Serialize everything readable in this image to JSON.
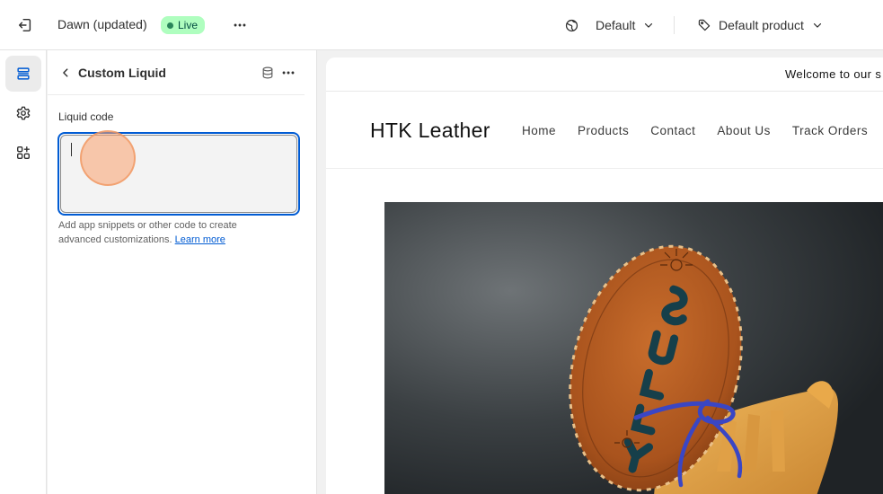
{
  "topbar": {
    "theme_name": "Dawn (updated)",
    "status_badge": "Live",
    "locale_label": "Default",
    "template_label": "Default product"
  },
  "rail": {
    "items": [
      {
        "icon": "sections-icon",
        "active": true
      },
      {
        "icon": "gear-icon",
        "active": false
      },
      {
        "icon": "apps-icon",
        "active": false
      }
    ]
  },
  "panel": {
    "title": "Custom Liquid",
    "field_label": "Liquid code",
    "code_value": "",
    "help_text": "Add app snippets or other code to create advanced customizations.",
    "help_link": "Learn more"
  },
  "preview": {
    "announcement": "Welcome to our s",
    "store_name": "HTK Leather",
    "nav": [
      "Home",
      "Products",
      "Contact",
      "About Us",
      "Track Orders"
    ]
  },
  "colors": {
    "accent": "#005bd3",
    "live_badge_bg": "#affebf",
    "live_badge_text": "#014b40"
  }
}
